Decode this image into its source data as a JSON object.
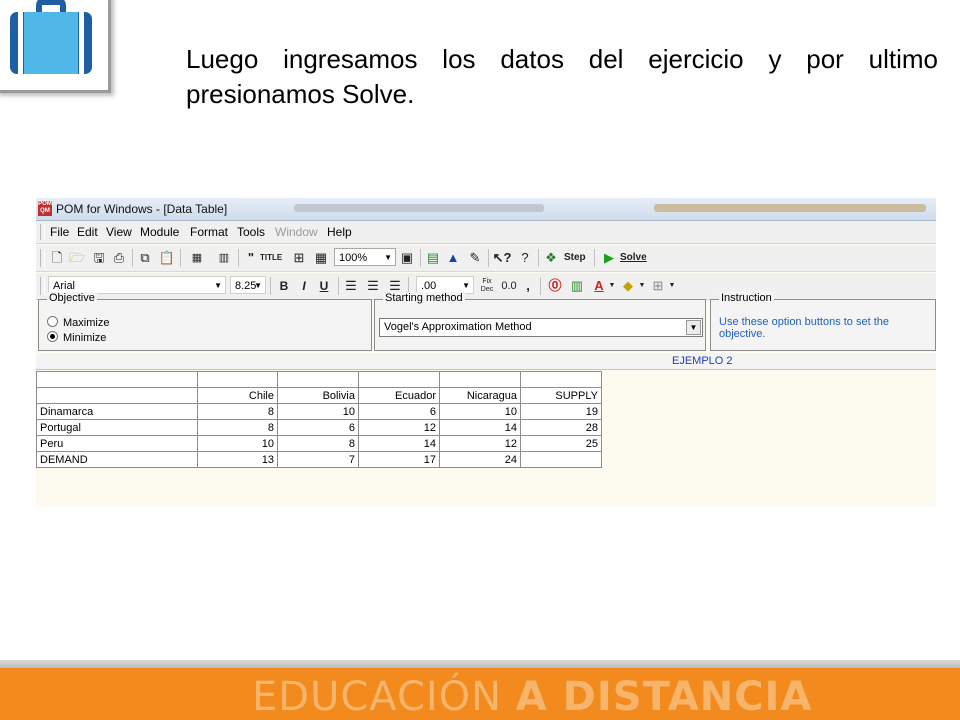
{
  "slide": {
    "text": "Luego ingresamos los datos del ejercicio y por ultimo presionamos Solve.",
    "footer_light": "EDUCACIÓN",
    "footer_bold": "A DISTANCIA"
  },
  "window": {
    "icon_label": "POM QM",
    "title": "POM for Windows - [Data Table]"
  },
  "menu": [
    "File",
    "Edit",
    "View",
    "Module",
    "Format",
    "Tools",
    "Window",
    "Help"
  ],
  "toolbar1": {
    "zoom": "100%",
    "step_label": "Step",
    "solve_label": "Solve",
    "title_icon": "TITLE"
  },
  "toolbar2": {
    "font": "Arial",
    "size": "8.25",
    "bold": "B",
    "italic": "I",
    "underline": "U",
    "decimals": ".00",
    "fix_top": "Fix",
    "fix_bottom": "Dec",
    "zero_decimals": "0.0",
    "comma": ","
  },
  "objective": {
    "legend": "Objective",
    "options": [
      "Maximize",
      "Minimize"
    ],
    "selected": "Minimize"
  },
  "starting_method": {
    "legend": "Starting method",
    "value": "Vogel's Approximation Method"
  },
  "instruction": {
    "legend": "Instruction",
    "text": "Use these option buttons to set the objective."
  },
  "problem_name": "EJEMPLO 2",
  "table": {
    "columns": [
      "",
      "Chile",
      "Bolivia",
      "Ecuador",
      "Nicaragua",
      "SUPPLY"
    ],
    "rows": [
      {
        "label": "Dinamarca",
        "values": [
          "8",
          "10",
          "6",
          "10",
          "19"
        ]
      },
      {
        "label": "Portugal",
        "values": [
          "8",
          "6",
          "12",
          "14",
          "28"
        ]
      },
      {
        "label": "Peru",
        "values": [
          "10",
          "8",
          "14",
          "12",
          "25"
        ]
      },
      {
        "label": "DEMAND",
        "values": [
          "13",
          "7",
          "17",
          "24",
          ""
        ]
      }
    ]
  },
  "colors": {
    "footer": "#f28a1e",
    "instruction_text": "#1f5fbf",
    "problem_name": "#1f3fb0",
    "data_background": "#fdfbef"
  }
}
